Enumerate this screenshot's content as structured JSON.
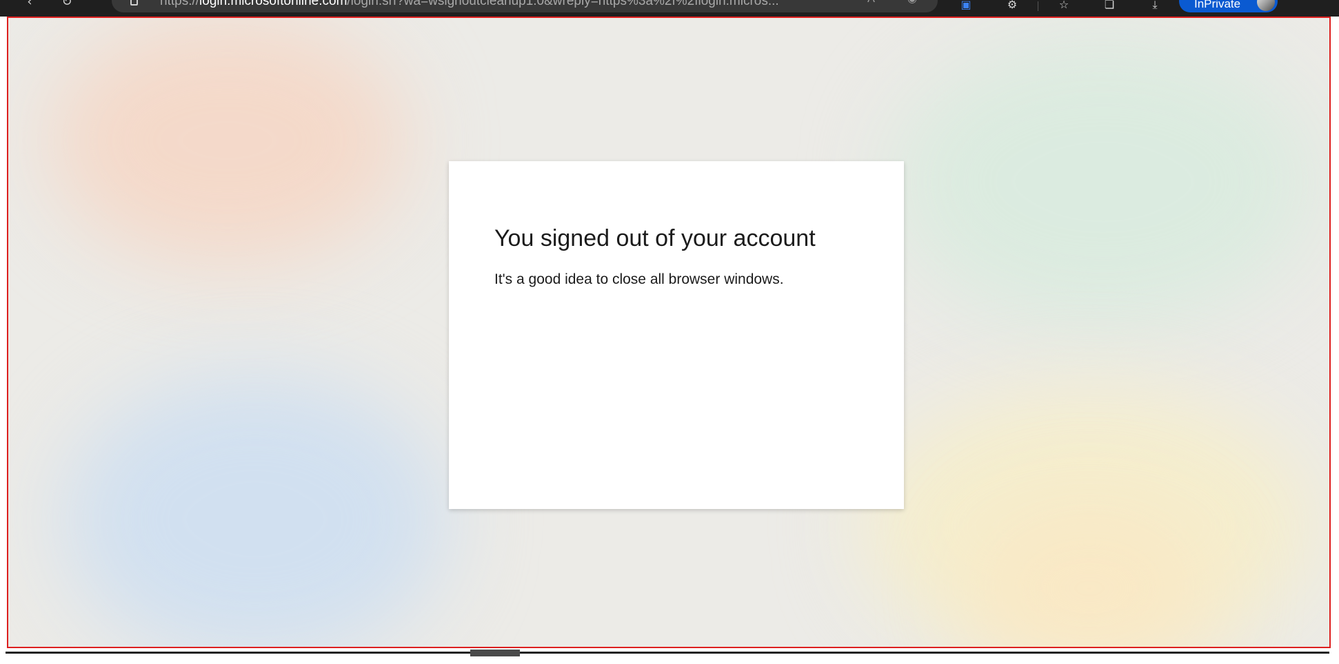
{
  "browser": {
    "url_scheme": "https://",
    "url_host": "login.microsoftonline.com",
    "url_path": "/login.srf?wa=wsignoutcleanup1.0&wreply=https%3a%2f%2flogin.micros...",
    "inprivate_label": "InPrivate"
  },
  "page": {
    "title": "You signed out of your account",
    "message": "It's a good idea to close all browser windows."
  },
  "colors": {
    "frame_outline": "#dd1f1f",
    "inprivate_badge": "#0a5ad1",
    "card_background": "#ffffff"
  }
}
